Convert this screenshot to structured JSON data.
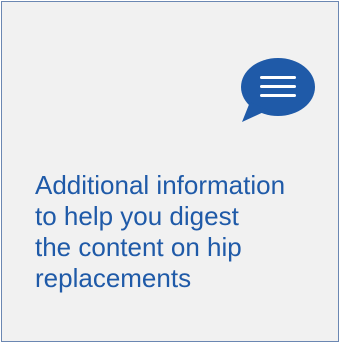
{
  "card": {
    "icon": "chat-bubble-icon",
    "text": "Additional information\nto help you digest\nthe content on hip\nreplacements"
  },
  "colors": {
    "background": "#f1f1f1",
    "border": "#6b87b2",
    "accent": "#1f5aa8"
  }
}
